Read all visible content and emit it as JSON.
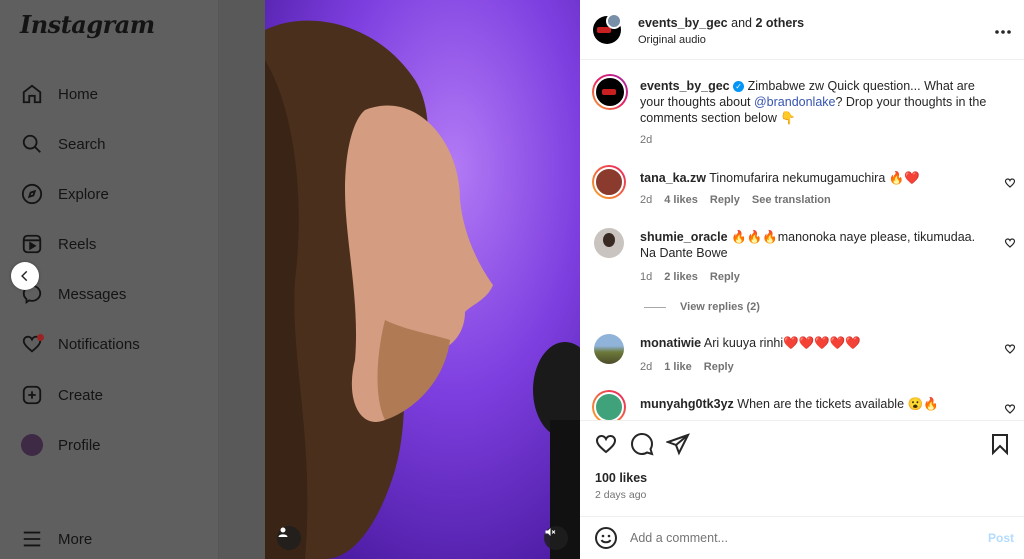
{
  "sidebar": {
    "logo": "Instagram",
    "items": [
      {
        "label": "Home",
        "icon": "home-icon"
      },
      {
        "label": "Search",
        "icon": "search-icon"
      },
      {
        "label": "Explore",
        "icon": "compass-icon"
      },
      {
        "label": "Reels",
        "icon": "reels-icon"
      },
      {
        "label": "Messages",
        "icon": "messenger-icon"
      },
      {
        "label": "Notifications",
        "icon": "heart-icon"
      },
      {
        "label": "Create",
        "icon": "plus-square-icon"
      },
      {
        "label": "Profile",
        "icon": "profile-avatar"
      }
    ],
    "more": "More"
  },
  "post": {
    "header_user": "events_by_gec",
    "header_and": "and",
    "header_others": "2 others",
    "audio": "Original audio",
    "caption_user": "events_by_gec",
    "caption_text": "Zimbabwe zw Quick question... What are your thoughts about",
    "caption_mention": "@brandonlake",
    "caption_text2": "? Drop your thoughts in the comments section below 👇",
    "caption_time": "2d"
  },
  "comments": [
    {
      "user": "tana_ka.zw",
      "text": "Tinomufarira nekumugamuchira 🔥❤️",
      "time": "2d",
      "likes": "4 likes",
      "reply": "Reply",
      "extra": "See translation"
    },
    {
      "user": "shumie_oracle",
      "text": "🔥🔥🔥manonoka naye please, tikumudaa. Na Dante Bowe",
      "time": "1d",
      "likes": "2 likes",
      "reply": "Reply",
      "view_replies": "View replies (2)"
    },
    {
      "user": "monatiwie",
      "text": "Ari kuuya rinhi❤️❤️❤️❤️❤️",
      "time": "2d",
      "likes": "1 like",
      "reply": "Reply"
    },
    {
      "user": "munyahg0tk3yz",
      "text": "When are the tickets available 😮🔥"
    }
  ],
  "footer": {
    "likes": "100 likes",
    "posted": "2 days ago",
    "comment_placeholder": "Add a comment...",
    "post_label": "Post"
  },
  "colors": {
    "accent": "#0095f6",
    "mention": "#00376b",
    "video_bg": "#7c3bd6"
  }
}
